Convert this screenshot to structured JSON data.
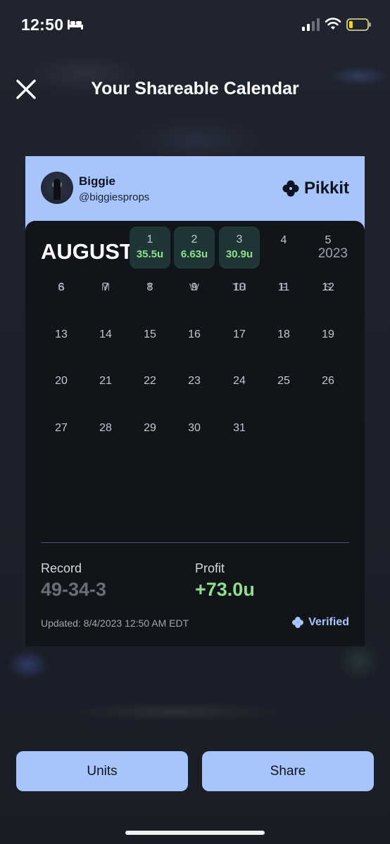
{
  "status_bar": {
    "time": "12:50",
    "icons": [
      "bed-icon",
      "cellular-signal-icon",
      "wifi-icon",
      "battery-icon"
    ]
  },
  "header": {
    "title": "Your Shareable Calendar",
    "close_icon": "close-icon"
  },
  "card": {
    "user": {
      "name": "Biggie",
      "handle": "@biggiesprops"
    },
    "brand": {
      "name": "Pikkit",
      "icon": "clover-icon"
    },
    "calendar": {
      "month": "AUGUST",
      "year": "2023",
      "weekdays": [
        "S",
        "M",
        "T",
        "W",
        "TH",
        "F",
        "S"
      ],
      "weeks": [
        [
          {
            "d": ""
          },
          {
            "d": ""
          },
          {
            "d": "1",
            "u": "35.5u"
          },
          {
            "d": "2",
            "u": "6.63u"
          },
          {
            "d": "3",
            "u": "30.9u"
          },
          {
            "d": "4"
          },
          {
            "d": "5"
          }
        ],
        [
          {
            "d": "6"
          },
          {
            "d": "7"
          },
          {
            "d": "8"
          },
          {
            "d": "9"
          },
          {
            "d": "10"
          },
          {
            "d": "11"
          },
          {
            "d": "12"
          }
        ],
        [
          {
            "d": "13"
          },
          {
            "d": "14"
          },
          {
            "d": "15"
          },
          {
            "d": "16"
          },
          {
            "d": "17"
          },
          {
            "d": "18"
          },
          {
            "d": "19"
          }
        ],
        [
          {
            "d": "20"
          },
          {
            "d": "21"
          },
          {
            "d": "22"
          },
          {
            "d": "23"
          },
          {
            "d": "24"
          },
          {
            "d": "25"
          },
          {
            "d": "26"
          }
        ],
        [
          {
            "d": "27"
          },
          {
            "d": "28"
          },
          {
            "d": "29"
          },
          {
            "d": "30"
          },
          {
            "d": "31"
          },
          {
            "d": ""
          },
          {
            "d": ""
          }
        ]
      ]
    },
    "stats": {
      "record_label": "Record",
      "record_value": "49-34-3",
      "profit_label": "Profit",
      "profit_value": "+73.0u"
    },
    "updated": "Updated: 8/4/2023 12:50 AM EDT",
    "verified": "Verified"
  },
  "buttons": {
    "units": "Units",
    "share": "Share"
  },
  "colors": {
    "background": "#1b1f2a",
    "accent": "#a8c5fb",
    "calendar_bg": "#111418",
    "profit_green": "#8fe08c",
    "win_cell": "#1f3536"
  }
}
